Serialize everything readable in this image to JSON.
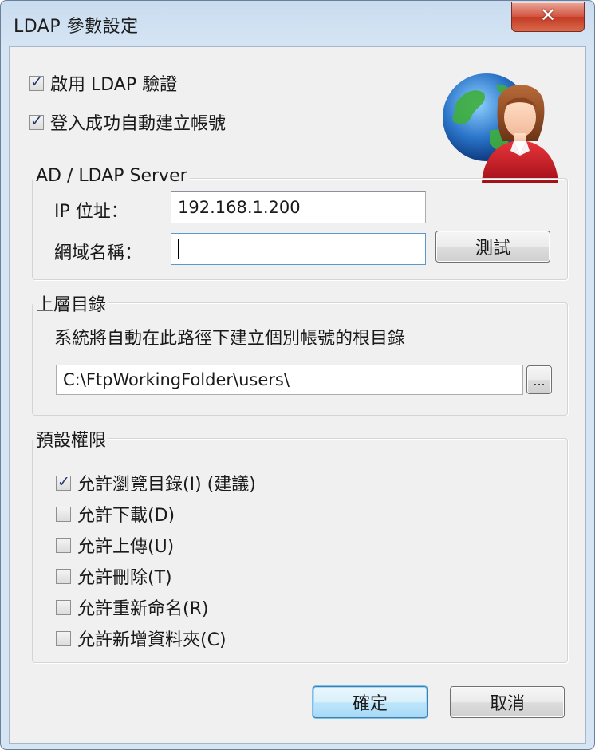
{
  "window": {
    "title": "LDAP 參數設定",
    "close_label": "✕"
  },
  "options": {
    "enable_ldap": {
      "label": "啟用 LDAP 驗證",
      "checked": true
    },
    "auto_create": {
      "label": "登入成功自動建立帳號",
      "checked": true
    }
  },
  "server_group": {
    "title": "AD / LDAP Server",
    "ip_label": "IP 位址：",
    "ip_value": "192.168.1.200",
    "domain_label": "網域名稱：",
    "domain_value": "",
    "test_button": "測試"
  },
  "root_group": {
    "title": "上層目錄",
    "description": "系統將自動在此路徑下建立個別帳號的根目錄",
    "path_value": "C:\\FtpWorkingFolder\\users\\",
    "browse_button": "..."
  },
  "permissions": {
    "title": "預設權限",
    "items": [
      {
        "label": "允許瀏覽目錄(I) (建議)",
        "checked": true
      },
      {
        "label": "允許下載(D)",
        "checked": false
      },
      {
        "label": "允許上傳(U)",
        "checked": false
      },
      {
        "label": "允許刪除(T)",
        "checked": false
      },
      {
        "label": "允許重新命名(R)",
        "checked": false
      },
      {
        "label": "允許新增資料夾(C)",
        "checked": false
      }
    ]
  },
  "buttons": {
    "ok": "確定",
    "cancel": "取消"
  },
  "colors": {
    "accent": "#3c7fb1",
    "close": "#c33a23",
    "dialog_bg": "#f0f0f0"
  }
}
